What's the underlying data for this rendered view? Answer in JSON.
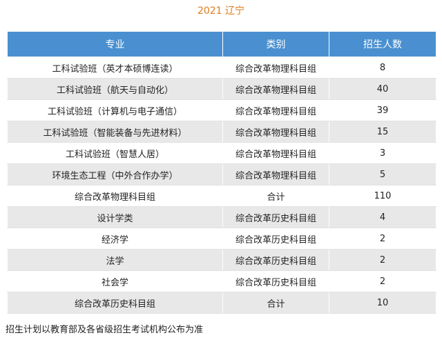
{
  "title": "2021 辽宁",
  "table": {
    "headers": [
      "专业",
      "类别",
      "招生人数"
    ],
    "rows": [
      [
        "工科试验班（英才本硕博连读）",
        "综合改革物理科目组",
        "8"
      ],
      [
        "工科试验班（航天与自动化）",
        "综合改革物理科目组",
        "40"
      ],
      [
        "工科试验班（计算机与电子通信）",
        "综合改革物理科目组",
        "39"
      ],
      [
        "工科试验班（智能装备与先进材料）",
        "综合改革物理科目组",
        "15"
      ],
      [
        "工科试验班（智慧人居）",
        "综合改革物理科目组",
        "3"
      ],
      [
        "环境生态工程（中外合作办学）",
        "综合改革物理科目组",
        "5"
      ],
      [
        "综合改革物理科目组",
        "合计",
        "110"
      ],
      [
        "设计学类",
        "综合改革历史科目组",
        "4"
      ],
      [
        "经济学",
        "综合改革历史科目组",
        "2"
      ],
      [
        "法学",
        "综合改革历史科目组",
        "2"
      ],
      [
        "社会学",
        "综合改革历史科目组",
        "2"
      ],
      [
        "综合改革历史科目组",
        "合计",
        "10"
      ]
    ]
  },
  "footnote": "招生计划以教育部及各省级招生考试机构公布为准",
  "colors": {
    "title": "#e07b1b",
    "header_bg": "#4a90d0",
    "stripe_bg": "#e8e8e8"
  }
}
